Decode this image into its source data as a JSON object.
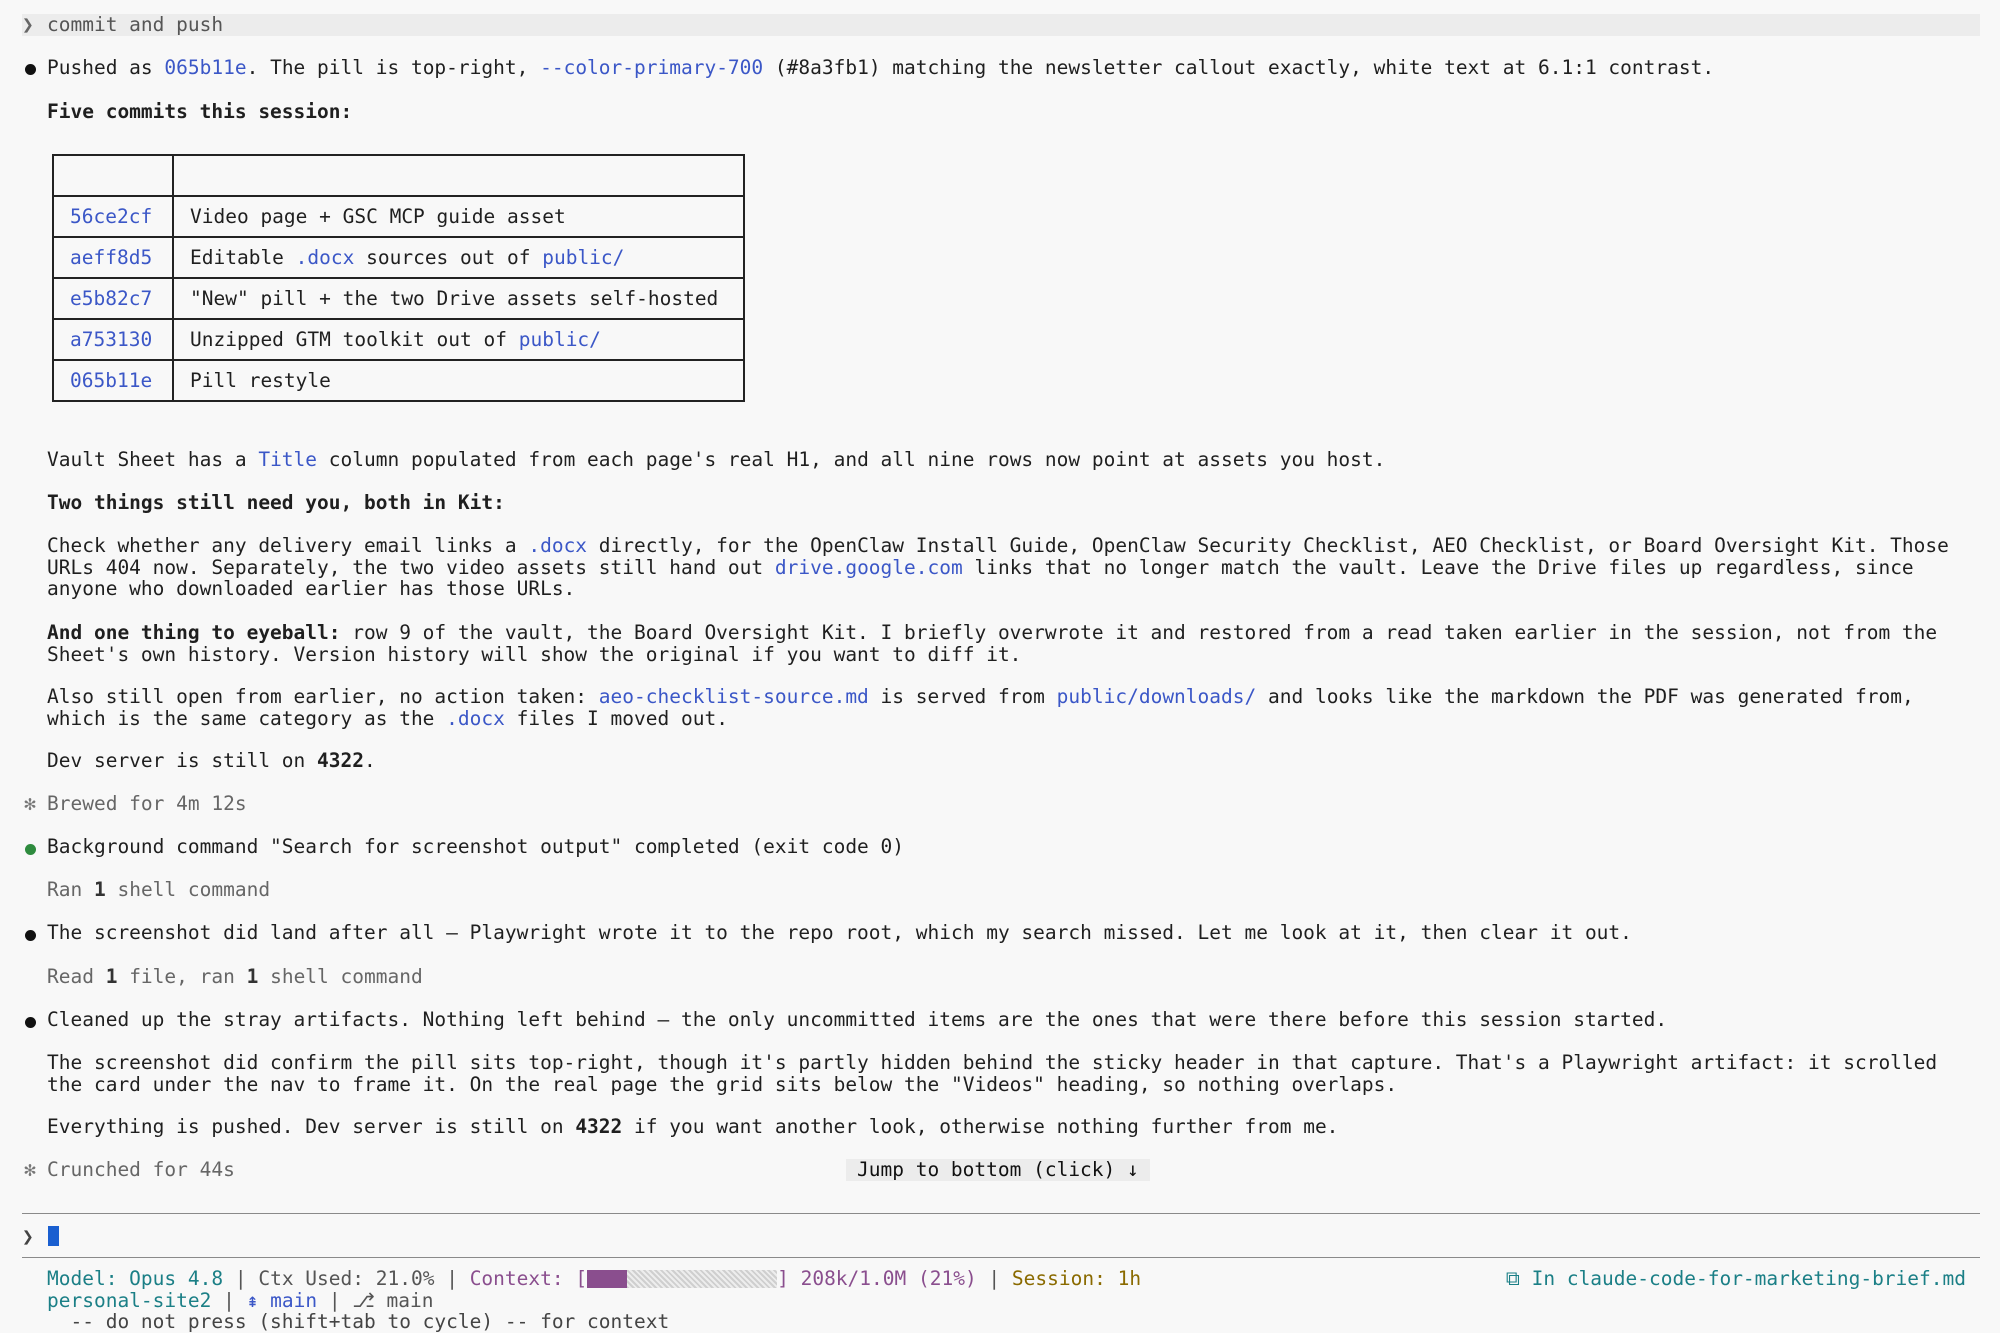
{
  "prompt": {
    "caret": "❯",
    "text": "commit and push"
  },
  "msg1": {
    "pre": "Pushed as ",
    "hash": "065b11e",
    "mid": ". The pill is top-right, ",
    "token": "--color-primary-700",
    "post": " (#8a3fb1) matching the newsletter callout exactly, white text at 6.1:1 contrast."
  },
  "commits_heading": "Five commits this session:",
  "commits": {
    "headers": [
      "",
      ""
    ],
    "rows": [
      {
        "hash": "56ce2cf",
        "pre": "Video page + GSC MCP guide asset",
        "code": "",
        "mid": "",
        "code2": ""
      },
      {
        "hash": "aeff8d5",
        "pre": "Editable ",
        "code": ".docx",
        "mid": " sources out of ",
        "code2": "public/"
      },
      {
        "hash": "e5b82c7",
        "pre": "\"New\" pill + the two Drive assets self-hosted",
        "code": "",
        "mid": "",
        "code2": ""
      },
      {
        "hash": "a753130",
        "pre": "Unzipped GTM toolkit out of ",
        "code": "public/",
        "mid": "",
        "code2": ""
      },
      {
        "hash": "065b11e",
        "pre": "Pill restyle",
        "code": "",
        "mid": "",
        "code2": ""
      }
    ]
  },
  "vault": {
    "pre": "Vault Sheet has a ",
    "code": "Title",
    "post": " column populated from each page's real H1, and all nine rows now point at assets you host."
  },
  "two_things": "Two things still need you, both in Kit:",
  "check": {
    "pre": "Check whether any delivery email links a ",
    "code": ".docx",
    "mid": " directly, for the OpenClaw Install Guide, OpenClaw Security Checklist, AEO Checklist, or Board Oversight Kit. Those URLs 404 now. Separately, the two video assets still hand out ",
    "link": "drive.google.com",
    "post": " links that no longer match the vault. Leave the Drive files up regardless, since anyone who downloaded earlier has those URLs."
  },
  "eyeball": {
    "bold": "And one thing to eyeball:",
    "post": " row 9 of the vault, the Board Oversight Kit. I briefly overwrote it and restored from a read taken earlier in the session, not from the Sheet's own history. Version history will show the original if you want to diff it."
  },
  "also": {
    "pre": "Also still open from earlier, no action taken: ",
    "code": "aeo-checklist-source.md",
    "mid": " is served from ",
    "code2": "public/downloads/",
    "mid2": " and looks like the markdown the PDF was generated from, which is the same category as the ",
    "code3": ".docx",
    "post": " files I moved out."
  },
  "dev1": {
    "pre": "Dev server is still on ",
    "port": "4322",
    "post": "."
  },
  "brewed": {
    "icon": "✻",
    "text": "Brewed for 4m 12s"
  },
  "bg": "Background command \"Search for screenshot output\" completed (exit code 0)",
  "ran1": {
    "pre": "Ran ",
    "n": "1",
    "post": " shell command"
  },
  "landed": "The screenshot did land after all — Playwright wrote it to the repo root, which my search missed. Let me look at it, then clear it out.",
  "read1": {
    "pre": "Read ",
    "n1": "1",
    "mid": " file, ran ",
    "n2": "1",
    "post": " shell command"
  },
  "cleaned": "Cleaned up the stray artifacts. Nothing left behind — the only uncommitted items are the ones that were there before this session started.",
  "confirm": "The screenshot did confirm the pill sits top-right, though it's partly hidden behind the sticky header in that capture. That's a Playwright artifact: it scrolled the card under the nav to frame it. On the real page the grid sits below the \"Videos\" heading, so nothing overlaps.",
  "pushed": {
    "pre": "Everything is pushed. Dev server is still on ",
    "port": "4322",
    "post": " if you want another look, otherwise nothing further from me."
  },
  "crunched": {
    "icon": "✻",
    "text": "Crunched for 44s"
  },
  "jump": "Jump to bottom (click) ↓",
  "input": {
    "caret": "❯"
  },
  "status": {
    "model": "Model: Opus 4.8",
    "sep": " | ",
    "ctx_used": "Ctx Used: 21.0%",
    "context_label": "Context: [",
    "context_fraction": 0.21,
    "context_end": "]",
    "context_val": " 208k/1.0M (21%)",
    "session_label": "Session: ",
    "session_val": "1h",
    "repo": "personal-site2",
    "branch_icon": "⇞",
    "branch": "main",
    "worktree_icon": "⎇",
    "worktree": "main",
    "in_file_icon": "⧉",
    "in_file": "In claude-code-for-marketing-brief.md",
    "line3": "  -- do not press (shift+tab to cycle) -- for context"
  },
  "colors": {
    "link": "#3b57c7",
    "teal": "#1b7f86",
    "purple": "#8a4e8e",
    "green_dot": "#2e8b3e"
  }
}
